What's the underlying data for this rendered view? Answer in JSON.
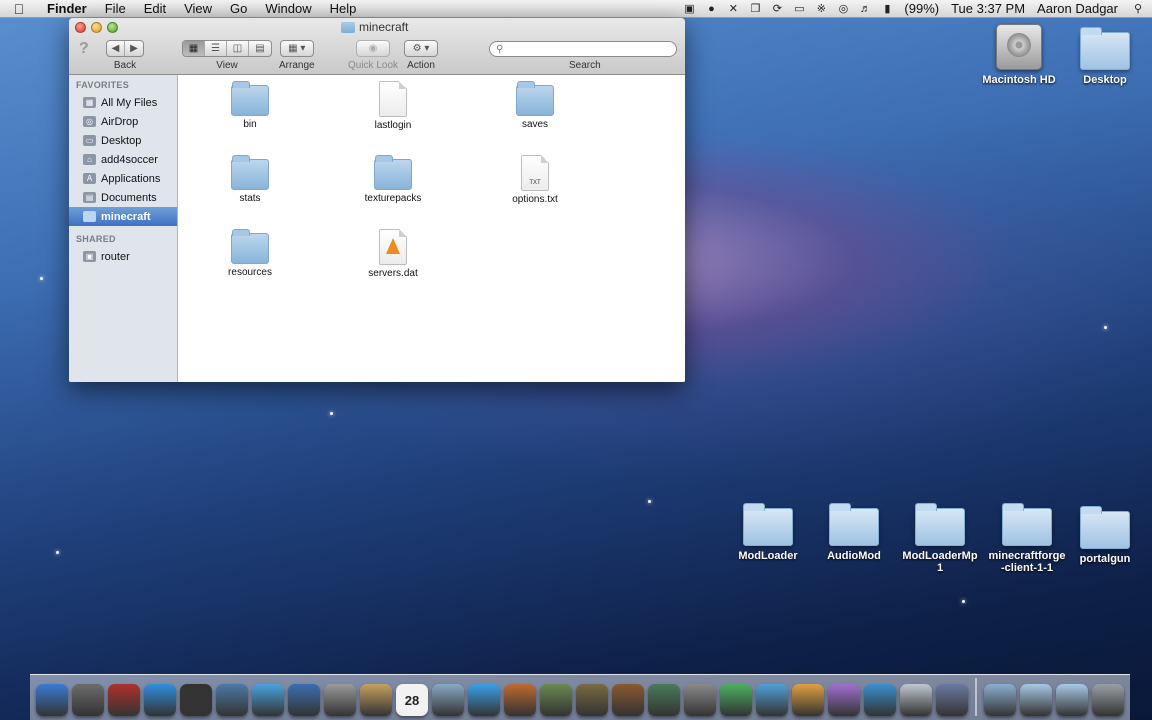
{
  "menubar": {
    "app_name": "Finder",
    "menus": [
      "File",
      "Edit",
      "View",
      "Go",
      "Window",
      "Help"
    ],
    "battery": "(99%)",
    "clock": "Tue 3:37 PM",
    "user": "Aaron Dadgar",
    "status_icons": [
      "screen-record-icon",
      "microphone-icon",
      "adobe-icon",
      "copy-icon",
      "sync-icon",
      "display-icon",
      "bluetooth-icon",
      "wifi-icon",
      "volume-icon",
      "battery-icon"
    ]
  },
  "window": {
    "title": "minecraft",
    "toolbar": {
      "back_label": "Back",
      "view_label": "View",
      "arrange_label": "Arrange",
      "quicklook_label": "Quick Look",
      "action_label": "Action",
      "search_label": "Search",
      "search_placeholder": ""
    },
    "sidebar": {
      "favorites_heading": "FAVORITES",
      "favorites": [
        {
          "label": "All My Files",
          "icon": "all-files-icon"
        },
        {
          "label": "AirDrop",
          "icon": "airdrop-icon"
        },
        {
          "label": "Desktop",
          "icon": "desktop-icon"
        },
        {
          "label": "add4soccer",
          "icon": "home-icon"
        },
        {
          "label": "Applications",
          "icon": "applications-icon"
        },
        {
          "label": "Documents",
          "icon": "documents-icon"
        },
        {
          "label": "minecraft",
          "icon": "folder-icon",
          "selected": true
        }
      ],
      "shared_heading": "SHARED",
      "shared": [
        {
          "label": "router",
          "icon": "server-icon"
        }
      ]
    },
    "files": [
      {
        "name": "bin",
        "kind": "folder"
      },
      {
        "name": "lastlogin",
        "kind": "document"
      },
      {
        "name": "saves",
        "kind": "folder"
      },
      {
        "name": "stats",
        "kind": "folder"
      },
      {
        "name": "texturepacks",
        "kind": "folder"
      },
      {
        "name": "options.txt",
        "kind": "text",
        "badge": "TXT"
      },
      {
        "name": "resources",
        "kind": "folder"
      },
      {
        "name": "servers.dat",
        "kind": "vlc"
      }
    ]
  },
  "desktop": {
    "items": [
      {
        "label": "Macintosh HD",
        "kind": "drive"
      },
      {
        "label": "Desktop",
        "kind": "folder"
      },
      {
        "label": "ModLoader",
        "kind": "folder"
      },
      {
        "label": "AudioMod",
        "kind": "folder"
      },
      {
        "label": "ModLoaderMp1",
        "kind": "folder"
      },
      {
        "label": "minecraftforge-client-1-1",
        "kind": "folder"
      },
      {
        "label": "portalgun",
        "kind": "folder"
      }
    ]
  },
  "dock": {
    "apps": [
      {
        "icon": "finder-icon",
        "color": "#3a7bd5"
      },
      {
        "icon": "launchpad-icon",
        "color": "#6c6c6c"
      },
      {
        "icon": "photo-booth-icon",
        "color": "#b0302a"
      },
      {
        "icon": "app-store-icon",
        "color": "#2f8ee0"
      },
      {
        "icon": "dashboard-icon",
        "color": "#333333"
      },
      {
        "icon": "xcode-icon",
        "color": "#4d79a8"
      },
      {
        "icon": "safari-icon",
        "color": "#4aa3e0"
      },
      {
        "icon": "facetime-icon",
        "color": "#3a6fb0"
      },
      {
        "icon": "video-icon",
        "color": "#9a9a9a"
      },
      {
        "icon": "contacts-icon",
        "color": "#c8a060"
      },
      {
        "icon": "calendar-icon",
        "color": "#d9d9d9",
        "text": "28"
      },
      {
        "icon": "preview-icon",
        "color": "#8aa9c8"
      },
      {
        "icon": "itunes-icon",
        "color": "#3aa0e8"
      },
      {
        "icon": "pen-icon",
        "color": "#c06a30"
      },
      {
        "icon": "iphoto-icon",
        "color": "#6a8a50"
      },
      {
        "icon": "imovie-icon",
        "color": "#7a6a40"
      },
      {
        "icon": "garageband-icon",
        "color": "#8a5a30"
      },
      {
        "icon": "time-machine-icon",
        "color": "#4a7a5a"
      },
      {
        "icon": "system-preferences-icon",
        "color": "#8a8a8a"
      },
      {
        "icon": "app-green-icon",
        "color": "#4ab060"
      },
      {
        "icon": "app-w-icon",
        "color": "#50a0d8"
      },
      {
        "icon": "app-p-icon",
        "color": "#e0a040"
      },
      {
        "icon": "app-e-icon",
        "color": "#a070d0"
      },
      {
        "icon": "messenger-icon",
        "color": "#3a90d0"
      },
      {
        "icon": "grid-app-icon",
        "color": "#c0c8d0"
      },
      {
        "icon": "clapper-icon",
        "color": "#6a7aa0"
      }
    ],
    "stacks": [
      {
        "icon": "downloads-stack-icon",
        "color": "#8ab0d0"
      },
      {
        "icon": "folder-stack-icon",
        "color": "#a8c8e6"
      },
      {
        "icon": "folder-stack-icon",
        "color": "#a8c8e6"
      },
      {
        "icon": "trash-icon",
        "color": "#9aa0a8"
      }
    ]
  }
}
